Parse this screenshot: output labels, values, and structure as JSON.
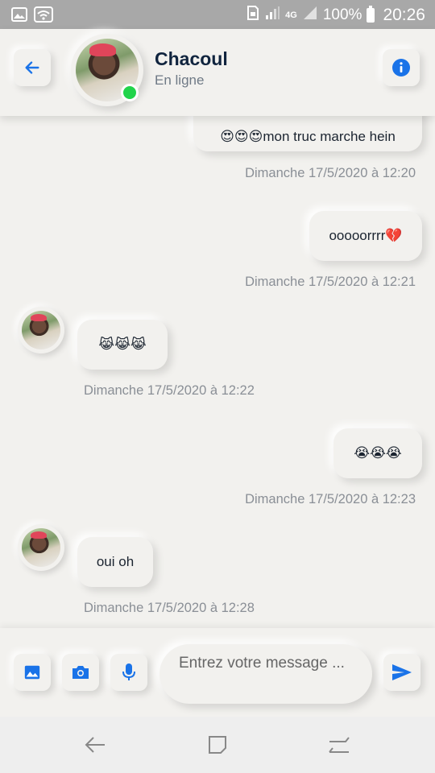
{
  "status_bar": {
    "network": "4G",
    "battery": "100%",
    "time": "20:26"
  },
  "header": {
    "contact_name": "Chacoul",
    "contact_status": "En ligne"
  },
  "messages": [
    {
      "side": "right",
      "text": "😍😍😍mon truc marche hein",
      "timestamp": "Dimanche 17/5/2020 à 12:20"
    },
    {
      "side": "right",
      "text": "ooooorrrr💔",
      "timestamp": "Dimanche 17/5/2020 à 12:21"
    },
    {
      "side": "left",
      "text": "😹😹😹",
      "timestamp": "Dimanche 17/5/2020 à 12:22"
    },
    {
      "side": "right",
      "text": "😭😭😭",
      "timestamp": "Dimanche 17/5/2020 à 12:23"
    },
    {
      "side": "left",
      "text": "oui oh",
      "timestamp": "Dimanche 17/5/2020 à 12:28"
    }
  ],
  "composer": {
    "placeholder": "Entrez votre message ..."
  },
  "colors": {
    "accent": "#1a73e8",
    "background": "#f2f1ee",
    "online": "#21d44b",
    "name": "#10243e"
  },
  "icons": {
    "back": "arrow-left-icon",
    "info": "info-icon",
    "gallery": "image-icon",
    "camera": "camera-icon",
    "mic": "microphone-icon",
    "send": "send-icon"
  }
}
